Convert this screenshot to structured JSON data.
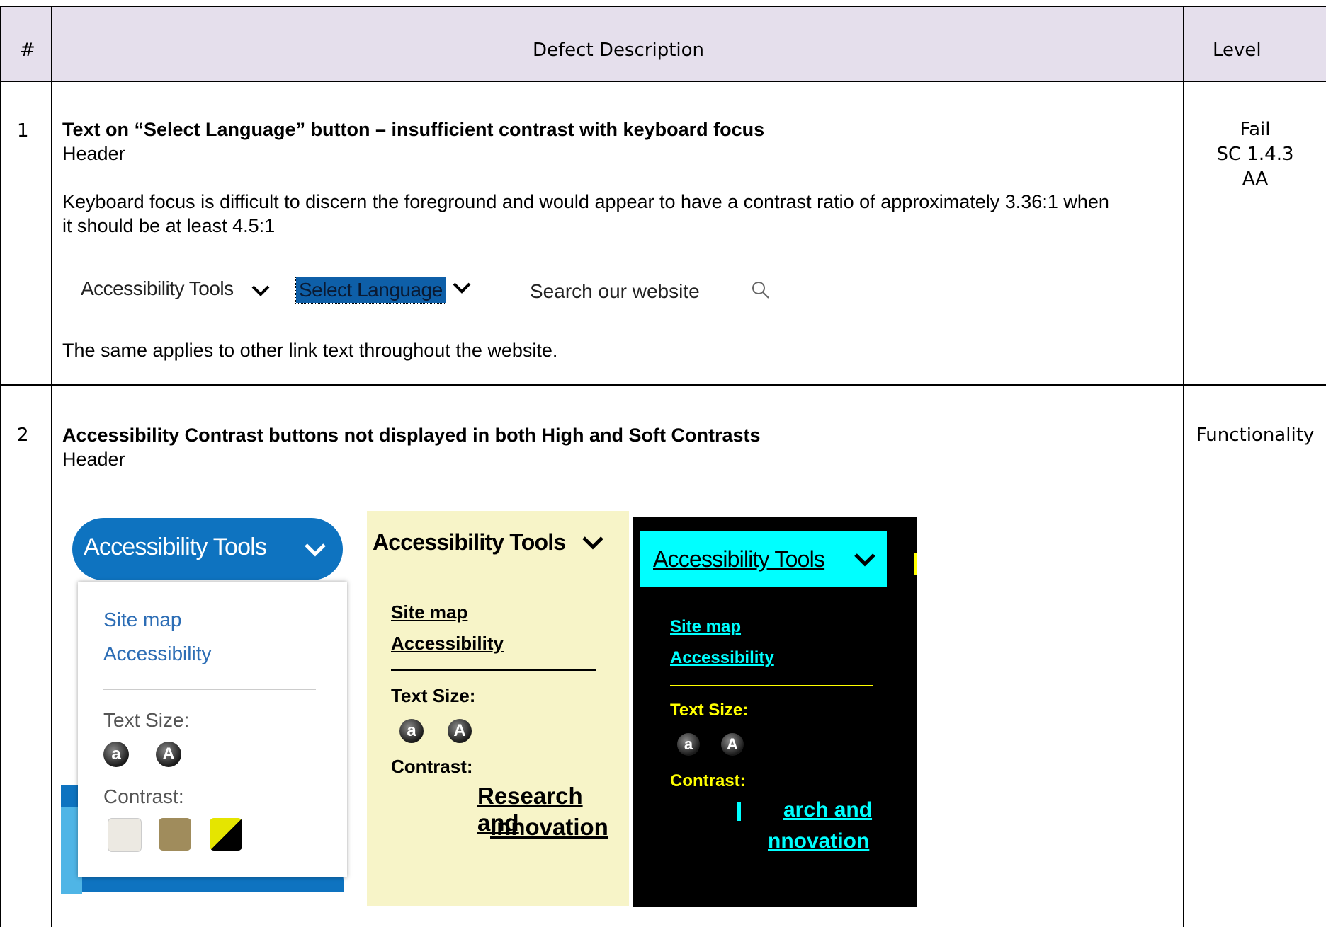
{
  "table": {
    "headers": {
      "num": "#",
      "desc": "Defect Description",
      "level": "Level"
    },
    "rows": [
      {
        "num": "1",
        "title": "Text on “Select Language” button – insufficient contrast with keyboard focus",
        "location": "Header",
        "body": "Keyboard focus is difficult to discern the foreground and would appear to have a contrast ratio of approximately 3.36:1 when it should be at least 4.5:1",
        "footer": "The same applies to other link text throughout the website.",
        "level_lines": [
          "Fail",
          "SC 1.4.3",
          "AA"
        ]
      },
      {
        "num": "2",
        "title": "Accessibility Contrast buttons not displayed in both High and Soft Contrasts",
        "location": "Header",
        "level_lines": [
          "Functionality"
        ]
      }
    ]
  },
  "screenshot1": {
    "accessibility_tools": "Accessibility Tools",
    "select_language": "Select Language",
    "search": "Search our website",
    "focus_color": "#0e5fa8"
  },
  "panels": {
    "default": {
      "button": "Accessibility Tools",
      "site_map": "Site map",
      "accessibility": "Accessibility",
      "text_size": "Text Size:",
      "small_a": "a",
      "large_a": "A",
      "contrast": "Contrast:",
      "swatch_colors": [
        "#ece9e2",
        "#a08c5c",
        "#e5e500"
      ]
    },
    "soft": {
      "button": "Accessibility Tools",
      "site_map": "Site map",
      "accessibility": "Accessibility",
      "text_size": "Text Size:",
      "small_a": "a",
      "large_a": "A",
      "contrast": "Contrast:",
      "link_line1": "Research and",
      "link_line2": "Innovation",
      "bg": "#f7f4c8"
    },
    "high": {
      "button": "Accessibility Tools",
      "site_map": "Site map",
      "accessibility": "Accessibility",
      "text_size": "Text Size:",
      "small_a": "a",
      "large_a": "A",
      "contrast": "Contrast:",
      "link_line1": "arch and",
      "link_line2": "nnovation",
      "cyan": "#00ffff",
      "yellow": "#ffff00"
    }
  }
}
